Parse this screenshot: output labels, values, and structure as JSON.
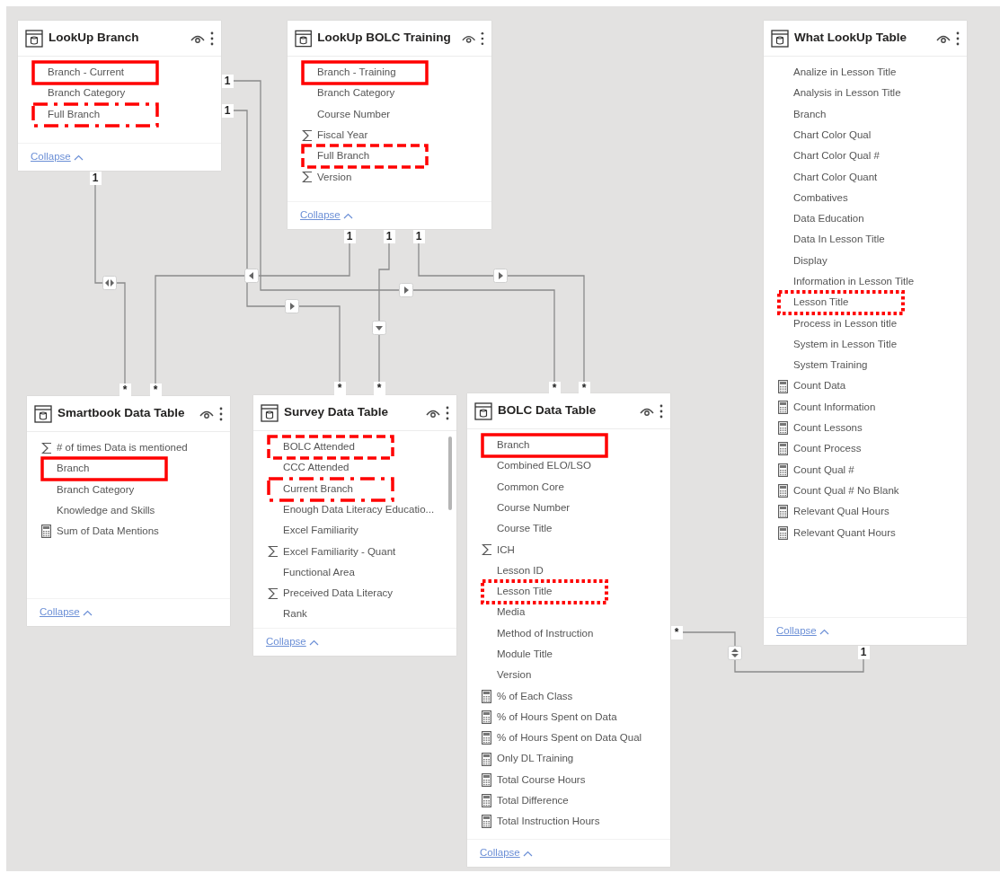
{
  "tables": [
    {
      "title": "LookUp Branch",
      "fields": [
        {
          "label": "Branch - Current",
          "kind": "column",
          "highlight": {
            "kind": "solid"
          }
        },
        {
          "label": "Branch Category",
          "kind": "column"
        },
        {
          "label": "Full Branch",
          "kind": "column",
          "highlight": {
            "kind": "dash-dot"
          }
        }
      ],
      "collapse": "Collapse"
    },
    {
      "title": "LookUp BOLC Training",
      "fields": [
        {
          "label": "Branch - Training",
          "kind": "column",
          "highlight": {
            "kind": "solid"
          }
        },
        {
          "label": "Branch Category",
          "kind": "column"
        },
        {
          "label": "Course Number",
          "kind": "column"
        },
        {
          "label": "Fiscal Year",
          "kind": "sum"
        },
        {
          "label": "Full Branch",
          "kind": "column",
          "highlight": {
            "kind": "dashed"
          }
        },
        {
          "label": "Version",
          "kind": "sum"
        }
      ],
      "collapse": "Collapse"
    },
    {
      "title": "What LookUp Table",
      "fields": [
        {
          "label": "Analize in Lesson Title",
          "kind": "column"
        },
        {
          "label": "Analysis in Lesson Title",
          "kind": "column"
        },
        {
          "label": "Branch",
          "kind": "column"
        },
        {
          "label": "Chart Color Qual",
          "kind": "column"
        },
        {
          "label": "Chart Color Qual #",
          "kind": "column"
        },
        {
          "label": "Chart Color Quant",
          "kind": "column"
        },
        {
          "label": "Combatives",
          "kind": "column"
        },
        {
          "label": "Data Education",
          "kind": "column"
        },
        {
          "label": "Data In Lesson Title",
          "kind": "column"
        },
        {
          "label": "Display",
          "kind": "column"
        },
        {
          "label": "Information in Lesson Title",
          "kind": "column"
        },
        {
          "label": "Lesson Title",
          "kind": "column",
          "highlight": {
            "kind": "dotted"
          }
        },
        {
          "label": "Process in Lesson title",
          "kind": "column"
        },
        {
          "label": "System in Lesson Title",
          "kind": "column"
        },
        {
          "label": "System Training",
          "kind": "column"
        },
        {
          "label": "Count Data",
          "kind": "measure"
        },
        {
          "label": "Count Information",
          "kind": "measure"
        },
        {
          "label": "Count Lessons",
          "kind": "measure"
        },
        {
          "label": "Count Process",
          "kind": "measure"
        },
        {
          "label": "Count Qual #",
          "kind": "measure"
        },
        {
          "label": "Count Qual # No Blank",
          "kind": "measure"
        },
        {
          "label": "Relevant Qual Hours",
          "kind": "measure"
        },
        {
          "label": "Relevant Quant Hours",
          "kind": "measure"
        }
      ],
      "collapse": "Collapse"
    },
    {
      "title": "Smartbook Data Table",
      "fields": [
        {
          "label": "# of times Data is mentioned",
          "kind": "sum"
        },
        {
          "label": "Branch",
          "kind": "column",
          "highlight": {
            "kind": "solid"
          }
        },
        {
          "label": "Branch Category",
          "kind": "column"
        },
        {
          "label": "Knowledge and Skills",
          "kind": "column"
        },
        {
          "label": "Sum of Data Mentions",
          "kind": "measure"
        }
      ],
      "collapse": "Collapse"
    },
    {
      "title": "Survey Data Table",
      "fields": [
        {
          "label": "BOLC Attended",
          "kind": "column",
          "highlight": {
            "kind": "dashed"
          }
        },
        {
          "label": "CCC Attended",
          "kind": "column"
        },
        {
          "label": "Current Branch",
          "kind": "column",
          "highlight": {
            "kind": "dash-dot"
          }
        },
        {
          "label": "Enough Data Literacy Educatio...",
          "kind": "column"
        },
        {
          "label": "Excel Familiarity",
          "kind": "column"
        },
        {
          "label": "Excel Familiarity - Quant",
          "kind": "sum"
        },
        {
          "label": "Functional Area",
          "kind": "column"
        },
        {
          "label": "Preceived Data Literacy",
          "kind": "sum"
        },
        {
          "label": "Rank",
          "kind": "column"
        }
      ],
      "collapse": "Collapse"
    },
    {
      "title": "BOLC Data Table",
      "fields": [
        {
          "label": "Branch",
          "kind": "column",
          "highlight": {
            "kind": "solid"
          }
        },
        {
          "label": "Combined ELO/LSO",
          "kind": "column"
        },
        {
          "label": "Common Core",
          "kind": "column"
        },
        {
          "label": "Course Number",
          "kind": "column"
        },
        {
          "label": "Course Title",
          "kind": "column"
        },
        {
          "label": "ICH",
          "kind": "sum"
        },
        {
          "label": "Lesson ID",
          "kind": "column"
        },
        {
          "label": "Lesson Title",
          "kind": "column",
          "highlight": {
            "kind": "dotted"
          }
        },
        {
          "label": "Media",
          "kind": "column"
        },
        {
          "label": "Method of Instruction",
          "kind": "column"
        },
        {
          "label": "Module Title",
          "kind": "column"
        },
        {
          "label": "Version",
          "kind": "column"
        },
        {
          "label": "% of Each Class",
          "kind": "measure"
        },
        {
          "label": "% of Hours Spent on Data",
          "kind": "measure"
        },
        {
          "label": "% of Hours Spent on Data Qual",
          "kind": "measure"
        },
        {
          "label": "Only DL Training",
          "kind": "measure"
        },
        {
          "label": "Total Course Hours",
          "kind": "measure"
        },
        {
          "label": "Total Difference",
          "kind": "measure"
        },
        {
          "label": "Total Instruction Hours",
          "kind": "measure"
        }
      ],
      "collapse": "Collapse"
    }
  ],
  "relationships": [
    {
      "one": "1",
      "many": "*",
      "bidirectional": true
    },
    {
      "one": "1",
      "many": "*",
      "bidirectional": false
    },
    {
      "one": "1",
      "many": "*",
      "bidirectional": false
    },
    {
      "one": "1",
      "many": "*",
      "bidirectional": false
    },
    {
      "one": "1",
      "many": "*",
      "bidirectional": false
    },
    {
      "one": "1",
      "many": "*",
      "bidirectional": false
    },
    {
      "one": "1",
      "many": "*",
      "bidirectional": true
    }
  ]
}
